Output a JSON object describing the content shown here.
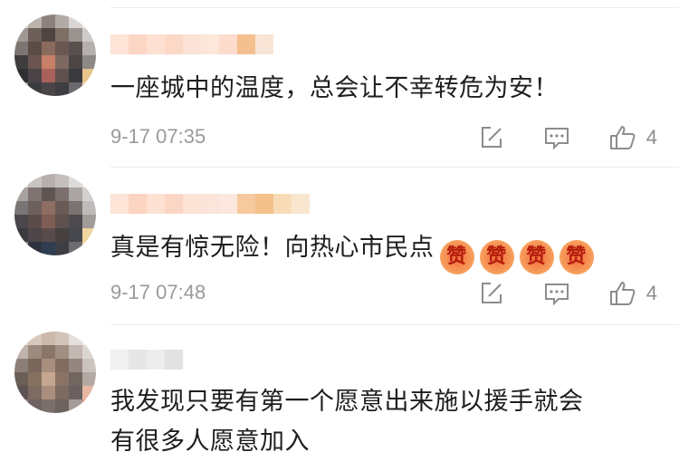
{
  "comments": [
    {
      "content": "一座城中的温度，总会让不幸转危为安！",
      "timestamp": "9-17 07:35",
      "like_count": "4",
      "emoji": []
    },
    {
      "content": "真是有惊无险！向热心市民点",
      "timestamp": "9-17 07:48",
      "like_count": "4",
      "emoji": [
        "赞",
        "赞",
        "赞",
        "赞"
      ]
    },
    {
      "content_line1": "我发现只要有第一个愿意出来施以援手就会",
      "content_line2": "有很多人愿意加入"
    }
  ],
  "icons": {
    "edit": "edit-icon",
    "comment": "comment-icon",
    "like": "thumbs-up-icon"
  },
  "colors": {
    "text": "#1e1e1e",
    "meta": "#9a9a9a",
    "icon": "#8c8c8c",
    "divider": "#ececec"
  }
}
